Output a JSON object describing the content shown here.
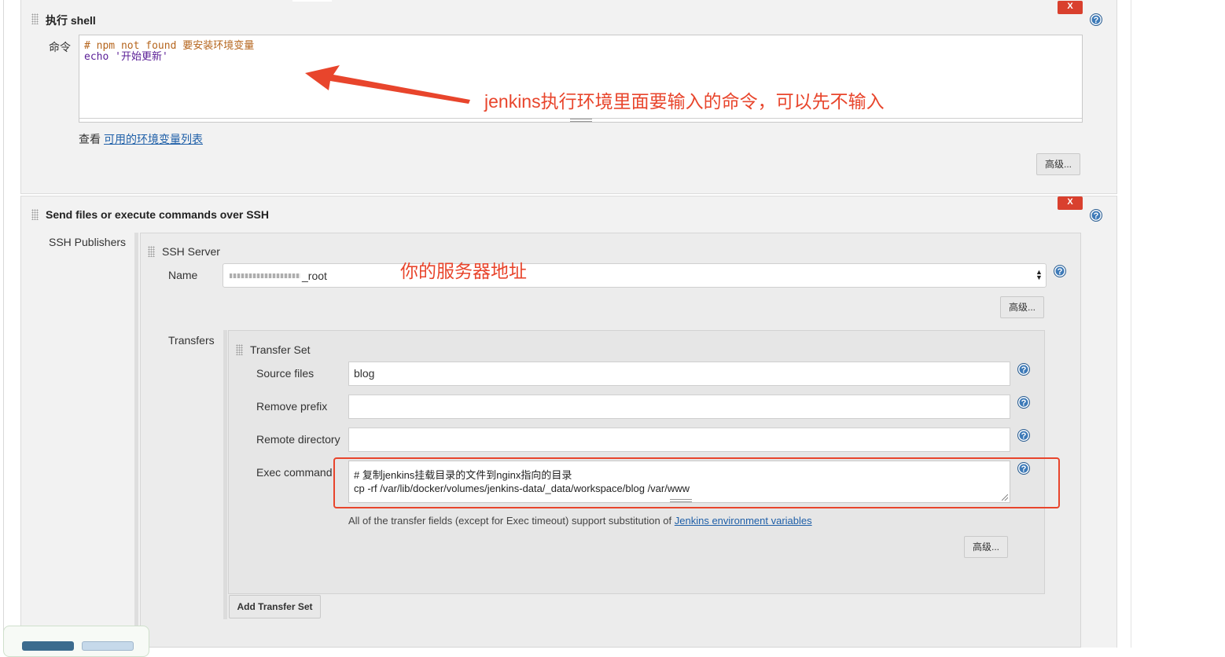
{
  "shell": {
    "title": "执行 shell",
    "delete_label": "X",
    "command_label": "命令",
    "command_lines": [
      "# npm not found 要安装环境变量",
      "echo '开始更新'"
    ],
    "see_text": "查看",
    "env_link": "可用的环境变量列表",
    "advanced_label": "高级..."
  },
  "ssh": {
    "title": "Send files or execute commands over SSH",
    "delete_label": "X",
    "publishers_label": "SSH Publishers",
    "server_title": "SSH Server",
    "name_label": "Name",
    "name_value": "_root",
    "server_advanced_label": "高级...",
    "transfers_label": "Transfers",
    "transfer_set_title": "Transfer Set",
    "source_files_label": "Source files",
    "source_files_value": "blog",
    "remove_prefix_label": "Remove prefix",
    "remove_prefix_value": "",
    "remote_directory_label": "Remote directory",
    "remote_directory_value": "",
    "exec_command_label": "Exec command",
    "exec_command_lines": [
      "# 复制jenkins挂载目录的文件到nginx指向的目录",
      "cp -rf /var/lib/docker/volumes/jenkins-data/_data/workspace/blog /var/www"
    ],
    "help_text": "All of the transfer fields (except for Exec timeout) support substitution of",
    "help_link": "Jenkins environment variables",
    "transfer_advanced_label": "高级...",
    "add_transfer_label": "Add Transfer Set"
  },
  "annotations": {
    "command_note": "jenkins执行环境里面要输入的命令，可以先不输入",
    "server_note": "你的服务器地址",
    "accent_color": "#e8452c"
  }
}
